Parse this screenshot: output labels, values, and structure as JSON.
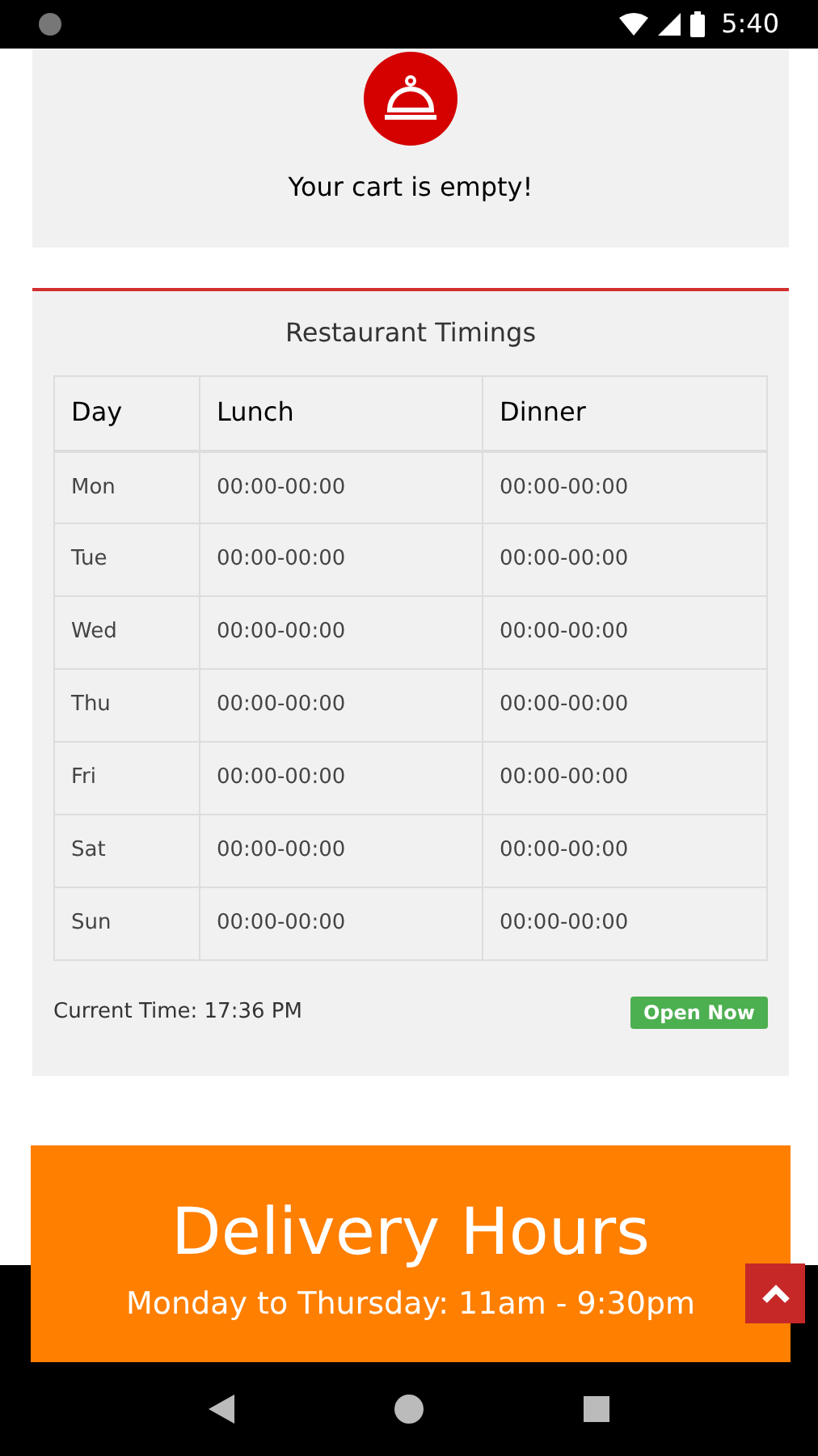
{
  "status_bar": {
    "time": "5:40"
  },
  "cart": {
    "message": "Your cart is empty!"
  },
  "timings": {
    "title": "Restaurant Timings",
    "columns": [
      "Day",
      "Lunch",
      "Dinner"
    ],
    "rows": [
      {
        "day": "Mon",
        "lunch": "00:00-00:00",
        "dinner": "00:00-00:00"
      },
      {
        "day": "Tue",
        "lunch": "00:00-00:00",
        "dinner": "00:00-00:00"
      },
      {
        "day": "Wed",
        "lunch": "00:00-00:00",
        "dinner": "00:00-00:00"
      },
      {
        "day": "Thu",
        "lunch": "00:00-00:00",
        "dinner": "00:00-00:00"
      },
      {
        "day": "Fri",
        "lunch": "00:00-00:00",
        "dinner": "00:00-00:00"
      },
      {
        "day": "Sat",
        "lunch": "00:00-00:00",
        "dinner": "00:00-00:00"
      },
      {
        "day": "Sun",
        "lunch": "00:00-00:00",
        "dinner": "00:00-00:00"
      }
    ],
    "current_time": "Current Time: 17:36 PM",
    "status_badge": "Open Now"
  },
  "delivery": {
    "title": "Delivery Hours",
    "line": "Monday to Thursday: 11am - 9:30pm"
  }
}
